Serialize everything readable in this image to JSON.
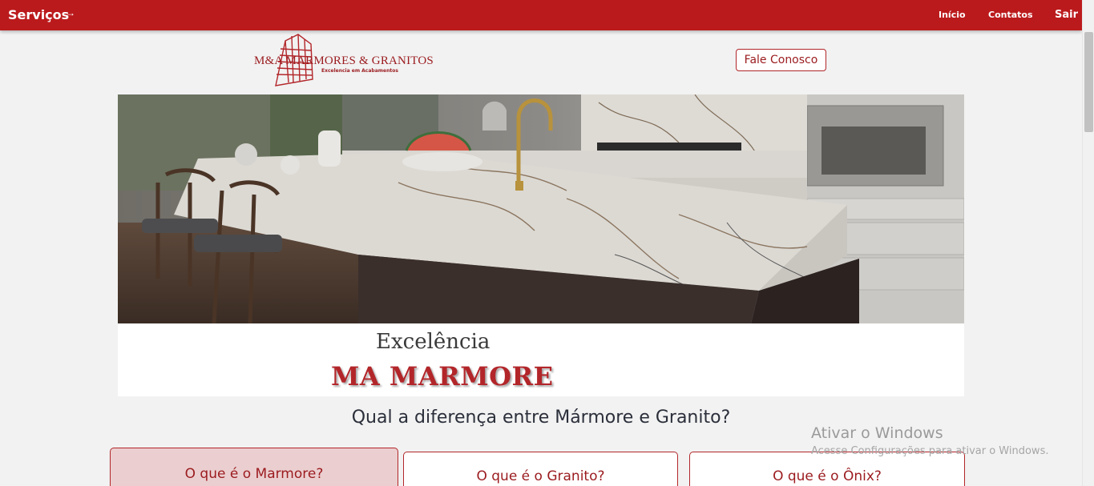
{
  "nav": {
    "brand": "Serviços",
    "brand_arrow": "→",
    "links": [
      "Início",
      "Contatos"
    ],
    "logout": "Sair"
  },
  "logo": {
    "name": "M&A MARMORES & GRANITOS",
    "tagline": "Excelencia em Acabamentos"
  },
  "header": {
    "contact_button": "Fale Conosco"
  },
  "hero": {
    "kicker": "Excelência",
    "title": "MA MARMORE"
  },
  "section": {
    "question": "Qual a diferença entre Mármore e Granito?",
    "cards": [
      "O que é o Marmore?",
      "O que é o Granito?",
      "O que é o Ônix?"
    ]
  },
  "watermark": {
    "title": "Ativar o Windows",
    "subtitle": "Acesse Configurações para ativar o Windows."
  },
  "colors": {
    "primary": "#bb1a1c",
    "accent_text": "#9b1b1f",
    "card_active_bg": "#ebcfd0"
  }
}
